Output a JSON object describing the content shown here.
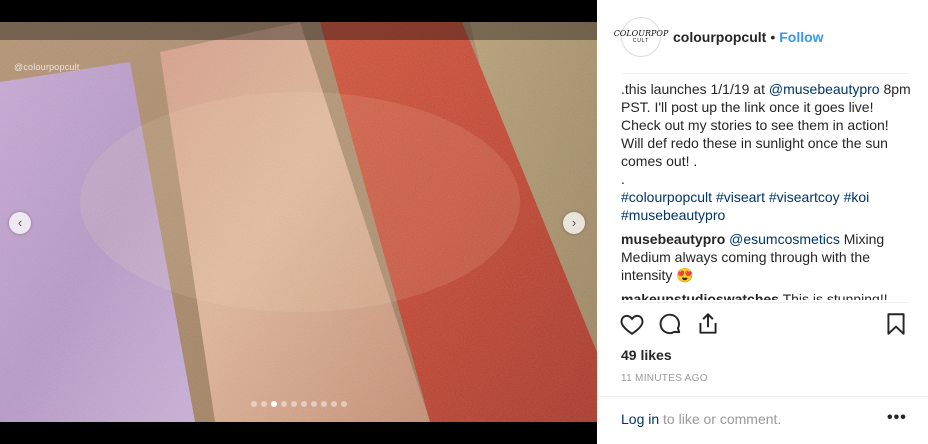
{
  "media": {
    "watermark": "@colourpopcult",
    "nav": {
      "prev_icon": "chevron-left-icon",
      "next_icon": "chevron-right-icon"
    },
    "carousel": {
      "total": 10,
      "active_index": 2
    }
  },
  "post": {
    "avatar": {
      "line1": "COLOURPOP",
      "line2": "CULT"
    },
    "username": "colourpopcult",
    "separator": "•",
    "follow_label": "Follow",
    "caption": {
      "text_1": ".this launches 1/1/19 at ",
      "mention": "@musebeautypro",
      "text_2": " 8pm PST. I'll post up the link once it goes live! Check out my stories to see them in action! Will def redo these in sunlight once the sun comes out! .",
      "dot_line": ".",
      "hashtags": [
        "#colourpopcult",
        "#viseart",
        "#viseartcoy",
        "#koi",
        "#musebeautypro"
      ]
    },
    "comments": [
      {
        "user": "musebeautypro",
        "mention": "@esumcosmetics",
        "text": " Mixing Medium always coming through with the intensity ",
        "emoji": "😍"
      },
      {
        "user": "makeupstudioswatches",
        "mention": "",
        "text": " This is stunning!!",
        "emoji": ""
      }
    ],
    "likes": "49 likes",
    "timestamp": "11 MINUTES AGO",
    "footer": {
      "login_label": "Log in",
      "rest": " to like or comment."
    },
    "more_label": "•••"
  },
  "icons": [
    "heart-icon",
    "comment-icon",
    "share-icon",
    "bookmark-icon",
    "more-options-icon"
  ],
  "colors": {
    "link": "#3897f0",
    "dark_link": "#003569",
    "muted": "#999999"
  }
}
